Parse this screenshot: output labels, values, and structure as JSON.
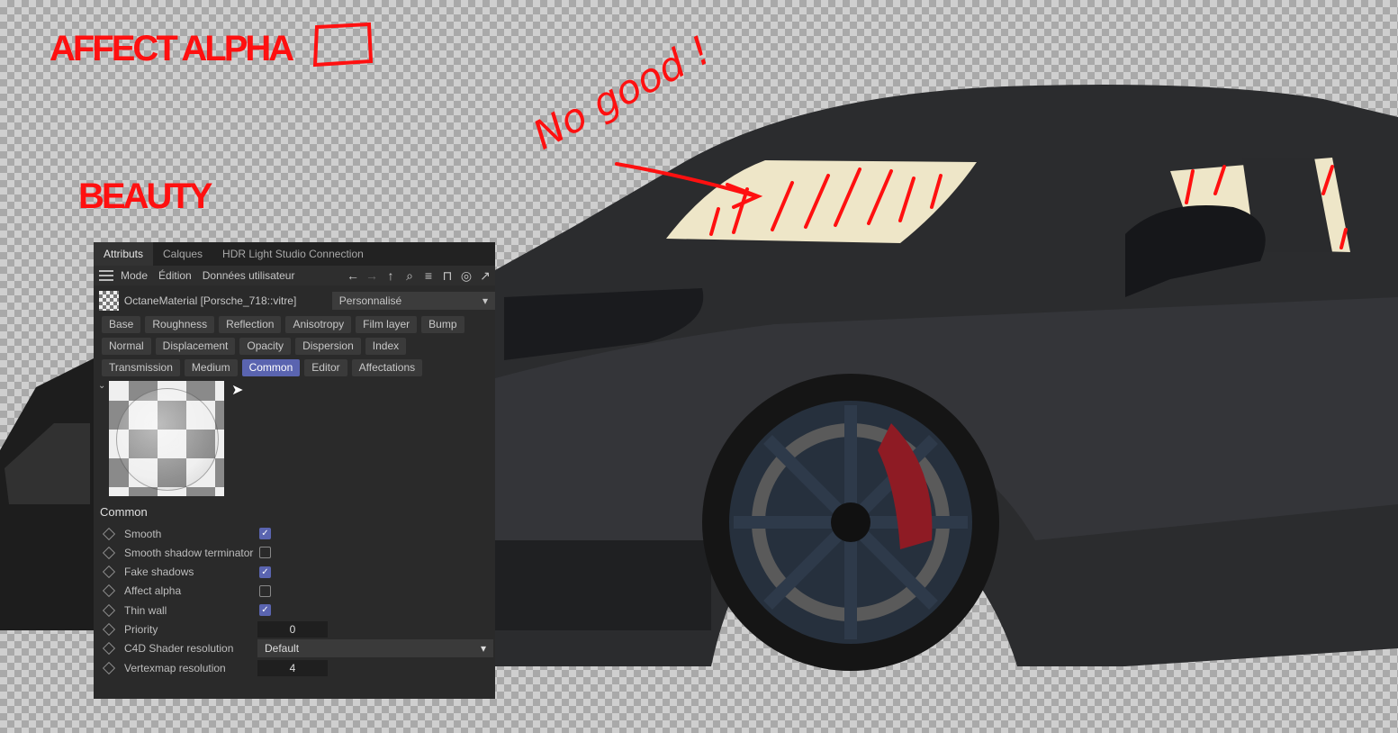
{
  "annotations": {
    "affect_alpha": "AFFECT ALPHA",
    "beauty": "BEAUTY",
    "note": "No good !"
  },
  "colors": {
    "annotation": "#ff1010",
    "accent": "#5a64b0"
  },
  "panel": {
    "tabs": [
      "Attributs",
      "Calques",
      "HDR Light Studio Connection"
    ],
    "active_tab": 0,
    "menu": [
      "Mode",
      "Édition",
      "Données utilisateur"
    ],
    "tool_icons": [
      "arrow-left-icon",
      "arrow-right-icon",
      "arrow-up-icon",
      "search-icon",
      "filter-icon",
      "lock-icon",
      "target-icon",
      "new-window-icon"
    ],
    "material_name": "OctaneMaterial [Porsche_718::vitre]",
    "preset": "Personnalisé",
    "channel_tabs": [
      [
        "Base",
        "Roughness",
        "Reflection",
        "Anisotropy",
        "Film layer",
        "Bump"
      ],
      [
        "Normal",
        "Displacement",
        "Opacity",
        "Dispersion",
        "Index"
      ],
      [
        "Transmission",
        "Medium",
        "Common",
        "Editor",
        "Affectations"
      ]
    ],
    "active_channel": "Common",
    "section_title": "Common",
    "properties": {
      "smooth": {
        "label": "Smooth",
        "checked": true
      },
      "smooth_shadow": {
        "label": "Smooth shadow terminator",
        "checked": false
      },
      "fake_shadows": {
        "label": "Fake shadows",
        "checked": true
      },
      "affect_alpha": {
        "label": "Affect alpha",
        "checked": false
      },
      "thin_wall": {
        "label": "Thin wall",
        "checked": true
      },
      "priority": {
        "label": "Priority",
        "value": "0"
      },
      "c4d_res": {
        "label": "C4D Shader resolution",
        "value": "Default"
      },
      "vertex_res": {
        "label": "Vertexmap resolution",
        "value": "4"
      }
    }
  }
}
